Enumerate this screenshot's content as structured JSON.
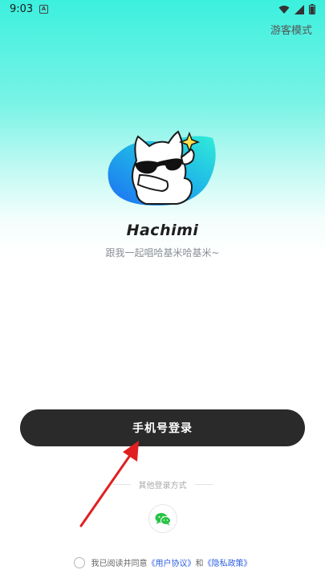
{
  "status_bar": {
    "time": "9:03",
    "notification_letter": "A"
  },
  "header": {
    "guest_mode": "游客模式"
  },
  "brand": {
    "app_name": "Hachimi",
    "tagline": "跟我一起唱哈基米哈基米~"
  },
  "login": {
    "phone_button": "手机号登录",
    "other_methods_label": "其他登录方式",
    "methods": [
      {
        "icon": "wechat-icon",
        "color": "#28c445"
      }
    ]
  },
  "agreement": {
    "prefix": "我已阅读并同意",
    "user_agreement": "《用户协议》",
    "conjunction": "和",
    "privacy_policy": "《隐私政策》",
    "checked": false
  },
  "colors": {
    "accent_dark": "#2a2a2a",
    "link": "#2d5fe3",
    "gradient_top": "#3cf0de",
    "annotation_arrow": "#e02020"
  }
}
